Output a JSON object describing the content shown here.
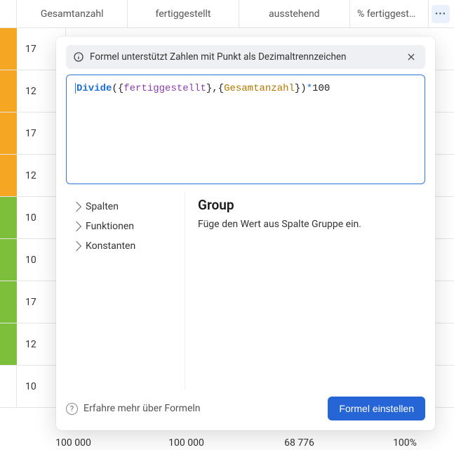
{
  "headers": {
    "col1": "Gesamtanzahl",
    "col2": "fertiggestellt",
    "col3": "ausstehend",
    "col4": "% fertiggest…"
  },
  "rows": {
    "visible_values": [
      "17",
      "12",
      "17",
      "12",
      "10",
      "10",
      "17",
      "12",
      "10"
    ]
  },
  "footer": {
    "c1": "100 000",
    "c2": "100 000",
    "c3": "68 776",
    "c4": "100%"
  },
  "popup": {
    "info_text": "Formel unterstützt Zahlen mit Punkt als Dezimaltrennzeichen",
    "formula": {
      "func": "Divide",
      "open1": "({",
      "arg1": "fertiggestellt",
      "mid": "},{",
      "arg2": "Gesamtanzahl",
      "close": "})",
      "star": "*",
      "num": "100"
    },
    "tree": {
      "columns": "Spalten",
      "functions": "Funktionen",
      "constants": "Konstanten"
    },
    "detail": {
      "title": "Group",
      "desc": "Füge den Wert aus Spalte Gruppe ein."
    },
    "footer": {
      "learn": "Erfahre mehr über Formeln",
      "apply": "Formel einstellen"
    }
  }
}
